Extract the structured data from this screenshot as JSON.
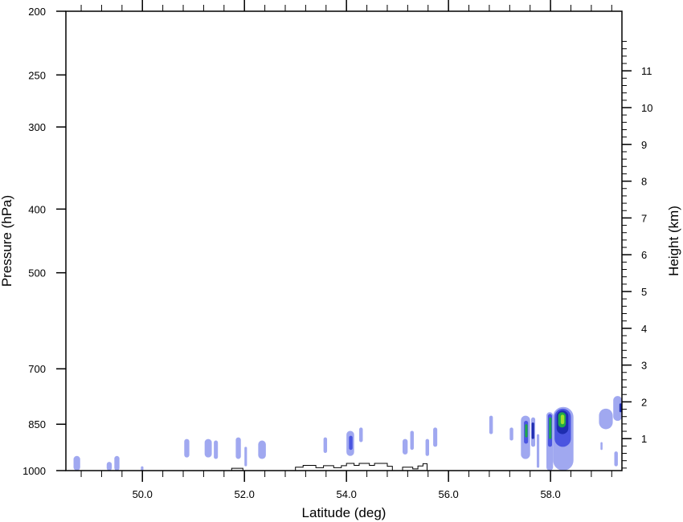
{
  "chart_data": {
    "type": "heatmap",
    "xlabel": "Latitude (deg)",
    "ylabel_left": "Pressure (hPa)",
    "ylabel_right": "Height (km)",
    "xlim": [
      48.5,
      59.4
    ],
    "ylim_pressure": [
      1000,
      200
    ],
    "pressure_scale": "log",
    "x_ticks": [
      {
        "value": 50,
        "label": "50.0"
      },
      {
        "value": 52,
        "label": "52.0"
      },
      {
        "value": 54,
        "label": "54.0"
      },
      {
        "value": 56,
        "label": "56.0"
      },
      {
        "value": 58,
        "label": "58.0"
      }
    ],
    "x_minor_tick_step": 0.4,
    "pressure_ticks": [
      {
        "value": 200,
        "label": "200"
      },
      {
        "value": 250,
        "label": "250"
      },
      {
        "value": 300,
        "label": "300"
      },
      {
        "value": 400,
        "label": "400"
      },
      {
        "value": 500,
        "label": "500"
      },
      {
        "value": 700,
        "label": "700"
      },
      {
        "value": 850,
        "label": "850"
      },
      {
        "value": 1000,
        "label": "1000"
      }
    ],
    "height_ticks": [
      {
        "value": 1,
        "label": "1"
      },
      {
        "value": 2,
        "label": "2"
      },
      {
        "value": 3,
        "label": "3"
      },
      {
        "value": 4,
        "label": "4"
      },
      {
        "value": 5,
        "label": "5"
      },
      {
        "value": 6,
        "label": "6"
      },
      {
        "value": 7,
        "label": "7"
      },
      {
        "value": 8,
        "label": "8"
      },
      {
        "value": 9,
        "label": "9"
      },
      {
        "value": 10,
        "label": "10"
      },
      {
        "value": 11,
        "label": "11"
      }
    ],
    "colors": {
      "level1": "#a0a8f0",
      "level2": "#4a55e0",
      "level3": "#1e2db0",
      "level4": "#1fa84a",
      "level5": "#9ee02a",
      "terrain": "#000000"
    },
    "features": [
      {
        "lat": [
          48.65,
          48.78
        ],
        "p": [
          1000,
          950
        ],
        "level": 1
      },
      {
        "lat": [
          49.3,
          49.4
        ],
        "p": [
          1000,
          970
        ],
        "level": 1
      },
      {
        "lat": [
          49.45,
          49.55
        ],
        "p": [
          1000,
          950
        ],
        "level": 1
      },
      {
        "lat": [
          49.97,
          50.02
        ],
        "p": [
          1000,
          985
        ],
        "level": 1
      },
      {
        "lat": [
          50.82,
          50.92
        ],
        "p": [
          955,
          895
        ],
        "level": 1
      },
      {
        "lat": [
          51.22,
          51.36
        ],
        "p": [
          955,
          895
        ],
        "level": 1
      },
      {
        "lat": [
          51.4,
          51.48
        ],
        "p": [
          960,
          900
        ],
        "level": 1
      },
      {
        "lat": [
          51.83,
          51.93
        ],
        "p": [
          960,
          890
        ],
        "level": 1
      },
      {
        "lat": [
          52.0,
          52.05
        ],
        "p": [
          985,
          920
        ],
        "level": 1
      },
      {
        "lat": [
          52.27,
          52.42
        ],
        "p": [
          960,
          900
        ],
        "level": 1
      },
      {
        "lat": [
          53.55,
          53.62
        ],
        "p": [
          940,
          890
        ],
        "level": 1
      },
      {
        "lat": [
          54.0,
          54.15
        ],
        "p": [
          950,
          870
        ],
        "level": 1
      },
      {
        "lat": [
          54.05,
          54.12
        ],
        "p": [
          930,
          885
        ],
        "level": 2
      },
      {
        "lat": [
          54.25,
          54.32
        ],
        "p": [
          905,
          860
        ],
        "level": 1
      },
      {
        "lat": [
          55.1,
          55.2
        ],
        "p": [
          945,
          895
        ],
        "level": 1
      },
      {
        "lat": [
          55.25,
          55.32
        ],
        "p": [
          930,
          870
        ],
        "level": 1
      },
      {
        "lat": [
          55.55,
          55.62
        ],
        "p": [
          950,
          895
        ],
        "level": 1
      },
      {
        "lat": [
          55.7,
          55.78
        ],
        "p": [
          920,
          860
        ],
        "level": 1
      },
      {
        "lat": [
          56.8,
          56.87
        ],
        "p": [
          880,
          825
        ],
        "level": 1
      },
      {
        "lat": [
          57.2,
          57.27
        ],
        "p": [
          900,
          860
        ],
        "level": 1
      },
      {
        "lat": [
          57.42,
          57.6
        ],
        "p": [
          960,
          825
        ],
        "level": 1
      },
      {
        "lat": [
          57.48,
          57.56
        ],
        "p": [
          910,
          840
        ],
        "level": 2
      },
      {
        "lat": [
          57.5,
          57.55
        ],
        "p": [
          890,
          850
        ],
        "level": 4
      },
      {
        "lat": [
          57.62,
          57.7
        ],
        "p": [
          920,
          830
        ],
        "level": 1
      },
      {
        "lat": [
          57.63,
          57.68
        ],
        "p": [
          895,
          845
        ],
        "level": 3
      },
      {
        "lat": [
          57.73,
          57.78
        ],
        "p": [
          990,
          880
        ],
        "level": 1
      },
      {
        "lat": [
          57.92,
          58.05
        ],
        "p": [
          1000,
          815
        ],
        "level": 1
      },
      {
        "lat": [
          57.95,
          58.03
        ],
        "p": [
          920,
          820
        ],
        "level": 2
      },
      {
        "lat": [
          57.97,
          58.02
        ],
        "p": [
          895,
          830
        ],
        "level": 4
      },
      {
        "lat": [
          58.05,
          58.45
        ],
        "p": [
          1000,
          800
        ],
        "level": 1
      },
      {
        "lat": [
          58.08,
          58.4
        ],
        "p": [
          920,
          805
        ],
        "level": 2
      },
      {
        "lat": [
          58.12,
          58.35
        ],
        "p": [
          880,
          810
        ],
        "level": 3
      },
      {
        "lat": [
          58.15,
          58.3
        ],
        "p": [
          860,
          815
        ],
        "level": 4
      },
      {
        "lat": [
          58.2,
          58.27
        ],
        "p": [
          850,
          822
        ],
        "level": 5
      },
      {
        "lat": [
          58.95,
          59.22
        ],
        "p": [
          865,
          805
        ],
        "level": 1
      },
      {
        "lat": [
          59.23,
          59.4
        ],
        "p": [
          840,
          770
        ],
        "level": 1
      },
      {
        "lat": [
          59.35,
          59.4
        ],
        "p": [
          815,
          790
        ],
        "level": 3
      },
      {
        "lat": [
          58.98,
          59.02
        ],
        "p": [
          930,
          905
        ],
        "level": 1
      },
      {
        "lat": [
          59.25,
          59.32
        ],
        "p": [
          985,
          935
        ],
        "level": 1
      }
    ],
    "terrain_profile": [
      [
        51.75,
        1000
      ],
      [
        51.75,
        992
      ],
      [
        51.97,
        992
      ],
      [
        51.97,
        1000
      ],
      [
        53.0,
        1000
      ],
      [
        53.0,
        988
      ],
      [
        53.15,
        988
      ],
      [
        53.15,
        982
      ],
      [
        53.4,
        982
      ],
      [
        53.4,
        990
      ],
      [
        53.55,
        990
      ],
      [
        53.55,
        983
      ],
      [
        53.75,
        983
      ],
      [
        53.75,
        990
      ],
      [
        53.9,
        990
      ],
      [
        53.9,
        983
      ],
      [
        54.0,
        983
      ],
      [
        54.0,
        975
      ],
      [
        54.15,
        975
      ],
      [
        54.15,
        982
      ],
      [
        54.25,
        982
      ],
      [
        54.25,
        975
      ],
      [
        54.45,
        975
      ],
      [
        54.45,
        982
      ],
      [
        54.55,
        982
      ],
      [
        54.55,
        975
      ],
      [
        54.8,
        975
      ],
      [
        54.8,
        985
      ],
      [
        54.9,
        985
      ],
      [
        54.9,
        1000
      ],
      [
        55.1,
        1000
      ],
      [
        55.1,
        988
      ],
      [
        55.3,
        988
      ],
      [
        55.3,
        994
      ],
      [
        55.4,
        994
      ],
      [
        55.4,
        984
      ],
      [
        55.5,
        984
      ],
      [
        55.5,
        976
      ],
      [
        55.58,
        976
      ],
      [
        55.58,
        1000
      ]
    ]
  }
}
